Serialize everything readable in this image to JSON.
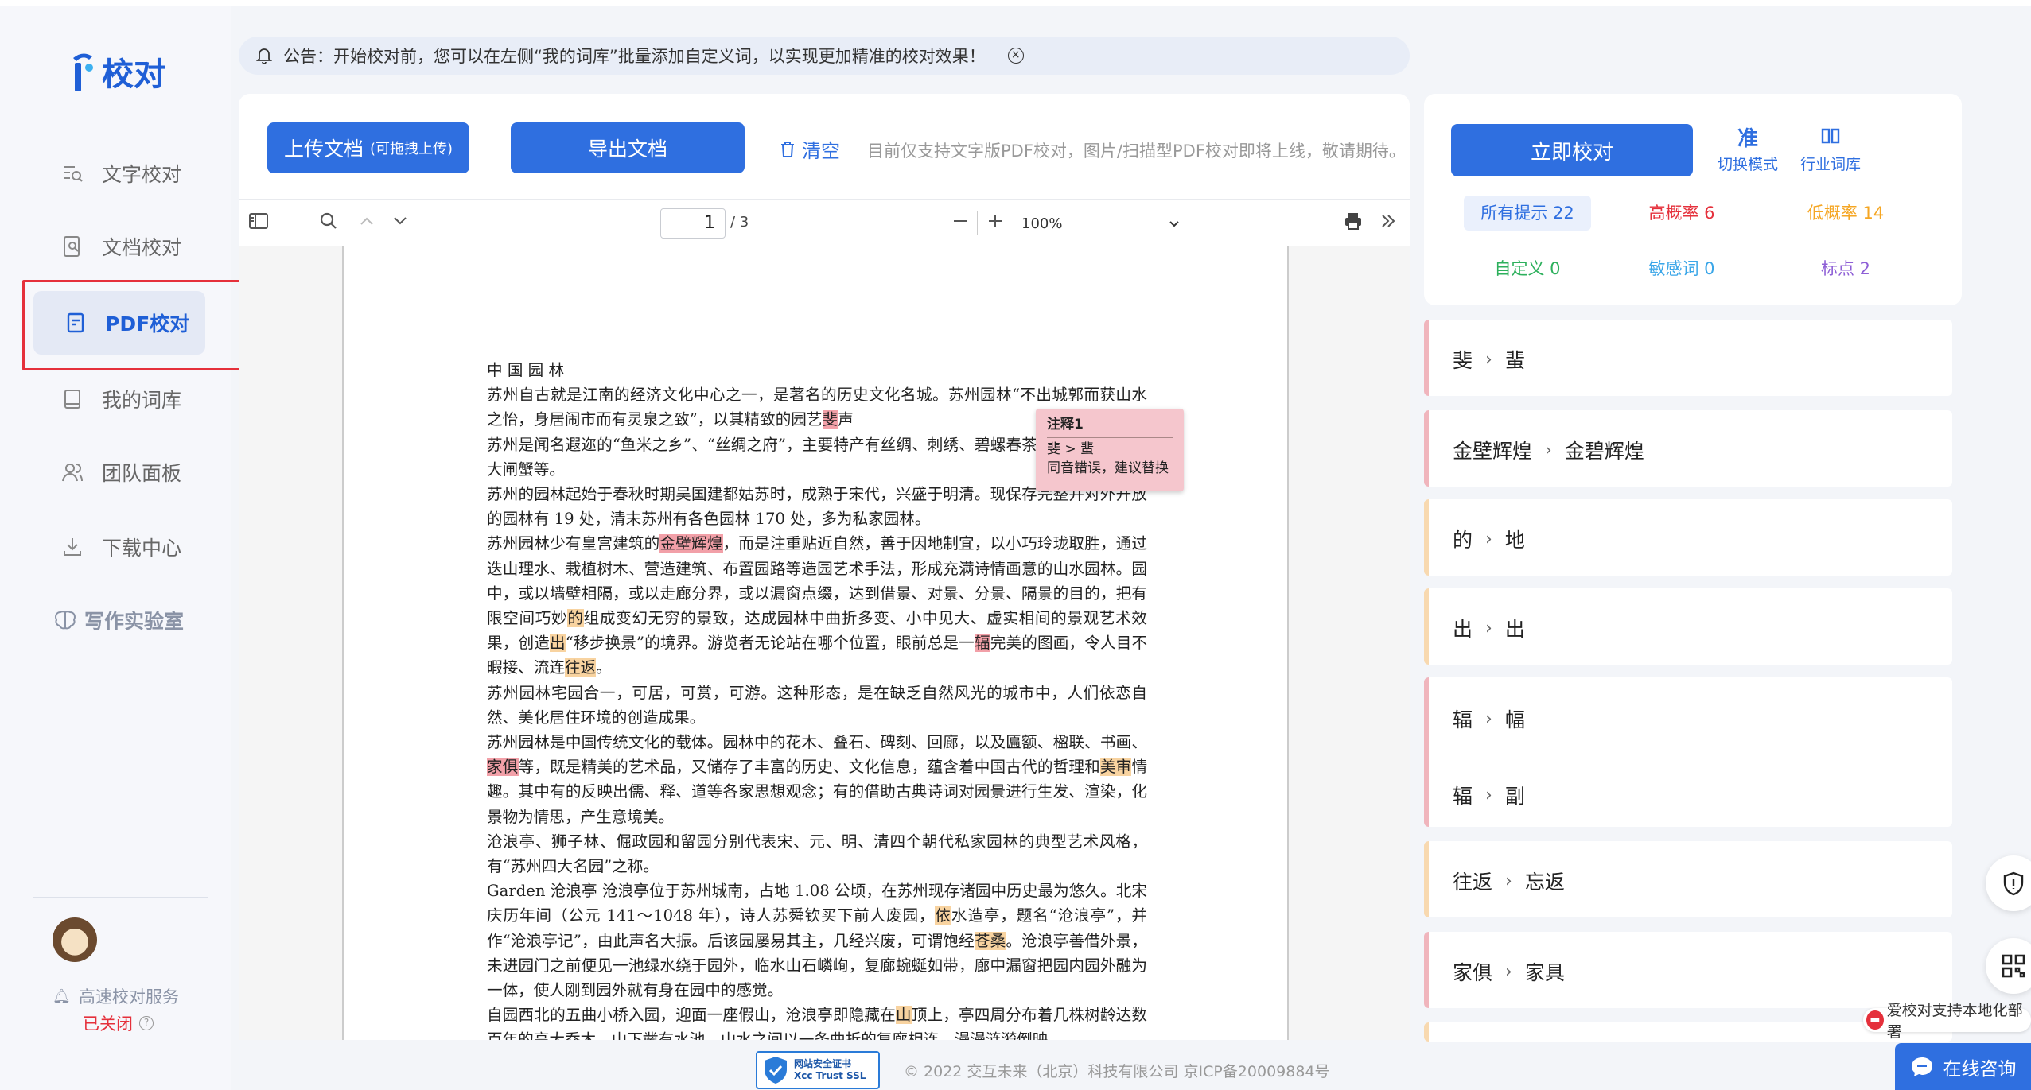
{
  "sidebar": {
    "logo_text": "校对",
    "nav": [
      {
        "label": "文字校对"
      },
      {
        "label": "文档校对"
      },
      {
        "label": "PDF校对"
      },
      {
        "label": "我的词库"
      },
      {
        "label": "团队面板"
      },
      {
        "label": "下载中心"
      }
    ],
    "lab_label": "写作实验室",
    "service_label": "高速校对服务",
    "service_status": "已关闭",
    "help_icon": "?"
  },
  "notice": {
    "text": "公告：开始校对前，您可以在左侧“我的词库”批量添加自定义词，以实现更加精准的校对效果！"
  },
  "toolbar": {
    "upload_label": "上传文档",
    "upload_hint": "(可拖拽上传)",
    "export_label": "导出文档",
    "clear_label": "清空",
    "tip": "目前仅支持文字版PDF校对，图片/扫描型PDF校对即将上线，敬请期待。"
  },
  "pdf": {
    "page_current": "1",
    "page_total": "/ 3",
    "zoom": "100%"
  },
  "doc": {
    "title": "中 国 园 林",
    "p1a": "苏州自古就是江南的经济文化中心之一，是著名的历史文化名城。苏州园林“不出城郭而获山水之怡，身居闹市而有灵泉之致”，以其精致的园艺",
    "p1_err": "斐",
    "p1b": "声",
    "p2": "苏州是闻名遐迩的“鱼米之乡”、“丝绸之府”，主要特产有丝绸、刺绣、碧螺春茶、银鱼、阳澄湖大闸蟹等。",
    "p3": "苏州的园林起始于春秋时期吴国建都姑苏时，成熟于宋代，兴盛于明清。现保存完整并对外开放的园林有 19 处，清末苏州有各色园林 170 处，多为私家园林。",
    "p4a": "苏州园林少有皇宫建筑的",
    "p4_err1": "金壁辉煌",
    "p4b": "，而是注重贴近自然，善于因地制宜，以小巧玲珑取胜，通过迭山理水、栽植树木、营造建筑、布置园路等造园艺术手法，形成充满诗情画意的山水园林。园中，或以墙壁相隔，或以走廊分界，或以漏窗点缀，达到借景、对景、分景、隔景的目的，把有限空间巧妙",
    "p4_err2": "的",
    "p4c": "组成变幻无穷的景致，达成园林中曲折多变、小中见大、虚实相间的景观艺术效果，创造",
    "p4_err3": "出",
    "p4d": "“移步换景”的境界。游览者无论站在哪个位置，眼前总是一",
    "p4_err4": "辐",
    "p4e": "完美的图画，令人目不暇接、流连",
    "p4_err5": "往返",
    "p4f": "。",
    "p5": "苏州园林宅园合一，可居，可赏，可游。这种形态，是在缺乏自然风光的城市中，人们依恋自然、美化居住环境的创造成果。",
    "p6a": "苏州园林是中国传统文化的载体。园林中的花木、叠石、碑刻、回廊，以及匾额、楹联、书画、",
    "p6_err1": "家俱",
    "p6b": "等，既是精美的艺术品，又储存了丰富的历史、文化信息，蕴含着中国古代的哲理和",
    "p6_err2": "美审",
    "p6c": "情趣。其中有的反映出儒、释、道等各家思想观念；有的借助古典诗词对园景进行生发、渲染，化景物为情思，产生意境美。",
    "p7": "沧浪亭、狮子林、倔政园和留园分别代表宋、元、明、清四个朝代私家园林的典型艺术风格，有“苏州四大名园”之称。",
    "p8a": "Garden 沧浪亭 沧浪亭位于苏州城南，占地 1.08 公顷，在苏州现存诸园中历史最为悠久。北宋庆历年间（公元 141〜1048 年），诗人苏舜钦买下前人废园，",
    "p8_err1": "依",
    "p8b": "水造亭，题名“沧浪亭”，并作“沧浪亭记”，由此声名大振。后该园屡易其主，几经兴废，可谓饱经",
    "p8_err2": "苍桑",
    "p8c": "。沧浪亭善借外景，未进园门之前便见一池绿水绕于园外，临水山石嶙峋，复廊蜿蜒如带，廊中漏窗把园内园外融为一体，使人刚到园外就有身在园中的感觉。",
    "p9a": "自园西北的五曲小桥入园，迎面一座假山，沧浪亭即隐藏在",
    "p9_err": "山",
    "p9b": "顶上，亭四周分布着几株树龄达数百年的高大乔木，山下凿有水池，山水之间以一条曲折的复廊相连，漫漫涟漪倒映"
  },
  "popup": {
    "title": "注释1",
    "line1": "斐 > 蜚",
    "line2": "同音错误，建议替换"
  },
  "right": {
    "check_label": "立即校对",
    "mode_glyph": "准",
    "mode_label": "切换模式",
    "dict_label": "行业词库",
    "stats": [
      {
        "label": "所有提示 22",
        "color": "#2f6fe0"
      },
      {
        "label": "高概率 6",
        "color": "#e5303b"
      },
      {
        "label": "低概率 14",
        "color": "#f5a623"
      },
      {
        "label": "自定义 0",
        "color": "#2db05c"
      },
      {
        "label": "敏感词 0",
        "color": "#3aa6e8"
      },
      {
        "label": "标点 2",
        "color": "#8e5fd6"
      }
    ],
    "corrections": [
      {
        "from": "斐",
        "to": "蜚"
      },
      {
        "from": "金壁辉煌",
        "to": "金碧辉煌"
      },
      {
        "from": "的",
        "to": "地"
      },
      {
        "from": "出",
        "to": "出"
      },
      {
        "from": "辐",
        "to": "幅"
      },
      {
        "from": "辐",
        "to": "副"
      },
      {
        "from": "往返",
        "to": "忘返"
      },
      {
        "from": "家俱",
        "to": "家具"
      }
    ]
  },
  "float": {
    "promo": "爱校对支持本地化部署",
    "chat": "在线咨询"
  },
  "footer": {
    "badge_line1": "网站安全证书",
    "badge_line2": "Xcc Trust SSL",
    "copyright": "© 2022 交互未来（北京）科技有限公司 京ICP备20009884号"
  }
}
